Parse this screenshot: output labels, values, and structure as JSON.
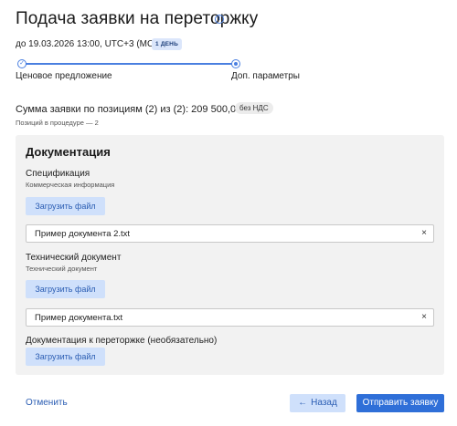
{
  "header": {
    "title": "Подача заявки на переторжку",
    "deadline": "до 19.03.2026 13:00, UTC+3 (МСК)",
    "deadline_badge": "1 ДЕНЬ"
  },
  "stepper": {
    "steps": [
      {
        "label": "Ценовое предложение",
        "state": "completed"
      },
      {
        "label": "Доп. параметры",
        "state": "current"
      }
    ]
  },
  "summary": {
    "sum_text": "Сумма заявки по позициям (2) из (2): 209 500,00 ₽",
    "vat_badge": "без НДС",
    "positions_text": "Позиций в процедуре — 2"
  },
  "documents": {
    "title": "Документация",
    "sections": [
      {
        "label": "Спецификация",
        "sublabel": "Коммерческая информация",
        "upload_label": "Загрузить файл",
        "file_name": "Пример документа 2.txt"
      },
      {
        "label": "Технический документ",
        "sublabel": "Технический документ",
        "upload_label": "Загрузить файл",
        "file_name": "Пример документа.txt"
      },
      {
        "label": "Документация к переторжке (необязательно)",
        "upload_label": "Загрузить файл"
      }
    ],
    "clear_glyph": "×"
  },
  "footer": {
    "cancel_label": "Отменить",
    "back_label": "Назад",
    "submit_label": "Отправить заявку"
  },
  "colors": {
    "accent": "#2f6fd8",
    "accent_light": "#cfe0fb",
    "card_bg": "#f2f2f2"
  },
  "icons": [
    "info-icon",
    "check-icon",
    "arrow-left-icon",
    "close-icon"
  ]
}
